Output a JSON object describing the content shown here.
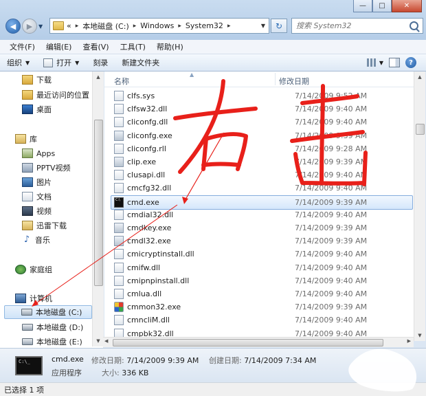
{
  "window": {
    "caption_buttons": {
      "minimize": "—",
      "maximize": "□",
      "close": "✕"
    }
  },
  "address": {
    "prefix": "«",
    "crumbs": [
      "本地磁盘 (C:)",
      "Windows",
      "System32"
    ],
    "sep": "▸"
  },
  "search": {
    "placeholder": "搜索 System32"
  },
  "menu": [
    "文件(F)",
    "编辑(E)",
    "查看(V)",
    "工具(T)",
    "帮助(H)"
  ],
  "toolbar": {
    "organize": "组织",
    "open": "打开",
    "burn": "刻录",
    "new_folder": "新建文件夹",
    "help": "?"
  },
  "nav": {
    "favorites": [
      {
        "label": "下载",
        "icon": "downloads-icon"
      },
      {
        "label": "最近访问的位置",
        "icon": "recent-places-icon"
      },
      {
        "label": "桌面",
        "icon": "desktop-icon"
      }
    ],
    "library_header": "库",
    "libraries": [
      {
        "label": "Apps",
        "icon": "apps-library-icon"
      },
      {
        "label": "PPTV视频",
        "icon": "pptv-library-icon"
      },
      {
        "label": "图片",
        "icon": "pictures-icon"
      },
      {
        "label": "文档",
        "icon": "documents-icon"
      },
      {
        "label": "视频",
        "icon": "videos-icon"
      },
      {
        "label": "迅雷下载",
        "icon": "xunlei-download-icon"
      },
      {
        "label": "音乐",
        "icon": "music-icon"
      }
    ],
    "homegroup": "家庭组",
    "computer_header": "计算机",
    "drives": [
      {
        "label": "本地磁盘 (C:)",
        "selected": true
      },
      {
        "label": "本地磁盘 (D:)",
        "selected": false
      },
      {
        "label": "本地磁盘 (E:)",
        "selected": false
      }
    ]
  },
  "columns": {
    "name": "名称",
    "date": "修改日期"
  },
  "files": [
    {
      "name": "clfs.sys",
      "date": "7/14/2009 9:52 AM",
      "kind": "sys"
    },
    {
      "name": "clfsw32.dll",
      "date": "7/14/2009 9:40 AM",
      "kind": "dll"
    },
    {
      "name": "cliconfg.dll",
      "date": "7/14/2009 9:40 AM",
      "kind": "dll"
    },
    {
      "name": "cliconfg.exe",
      "date": "7/14/2009 9:39 AM",
      "kind": "exe"
    },
    {
      "name": "cliconfg.rll",
      "date": "7/14/2009 9:28 AM",
      "kind": "dll"
    },
    {
      "name": "clip.exe",
      "date": "7/14/2009 9:39 AM",
      "kind": "exe"
    },
    {
      "name": "clusapi.dll",
      "date": "7/14/2009 9:40 AM",
      "kind": "dll"
    },
    {
      "name": "cmcfg32.dll",
      "date": "7/14/2009 9:40 AM",
      "kind": "dll"
    },
    {
      "name": "cmd.exe",
      "date": "7/14/2009 9:39 AM",
      "kind": "cmd",
      "selected": true
    },
    {
      "name": "cmdial32.dll",
      "date": "7/14/2009 9:40 AM",
      "kind": "dll"
    },
    {
      "name": "cmdkey.exe",
      "date": "7/14/2009 9:39 AM",
      "kind": "exe"
    },
    {
      "name": "cmdl32.exe",
      "date": "7/14/2009 9:39 AM",
      "kind": "exe"
    },
    {
      "name": "cmicryptinstall.dll",
      "date": "7/14/2009 9:40 AM",
      "kind": "dll"
    },
    {
      "name": "cmifw.dll",
      "date": "7/14/2009 9:40 AM",
      "kind": "dll"
    },
    {
      "name": "cmipnpinstall.dll",
      "date": "7/14/2009 9:40 AM",
      "kind": "dll"
    },
    {
      "name": "cmlua.dll",
      "date": "7/14/2009 9:40 AM",
      "kind": "dll"
    },
    {
      "name": "cmmon32.exe",
      "date": "7/14/2009 9:39 AM",
      "kind": "mon"
    },
    {
      "name": "cmncliM.dll",
      "date": "7/14/2009 9:40 AM",
      "kind": "dll"
    },
    {
      "name": "cmpbk32.dll",
      "date": "7/14/2009 9:40 AM",
      "kind": "dll"
    }
  ],
  "details": {
    "name": "cmd.exe",
    "type": "应用程序",
    "modified_label": "修改日期:",
    "modified": "7/14/2009 9:39 AM",
    "created_label": "创建日期:",
    "created": "7/14/2009 7:34 AM",
    "size_label": "大小:",
    "size": "336 KB"
  },
  "status": "已选择 1 项",
  "annotation": {
    "handwriting": "右击",
    "color": "#e8201a"
  },
  "colors": {
    "selection": "#cfe3f8",
    "accent": "#1f5ea8"
  }
}
